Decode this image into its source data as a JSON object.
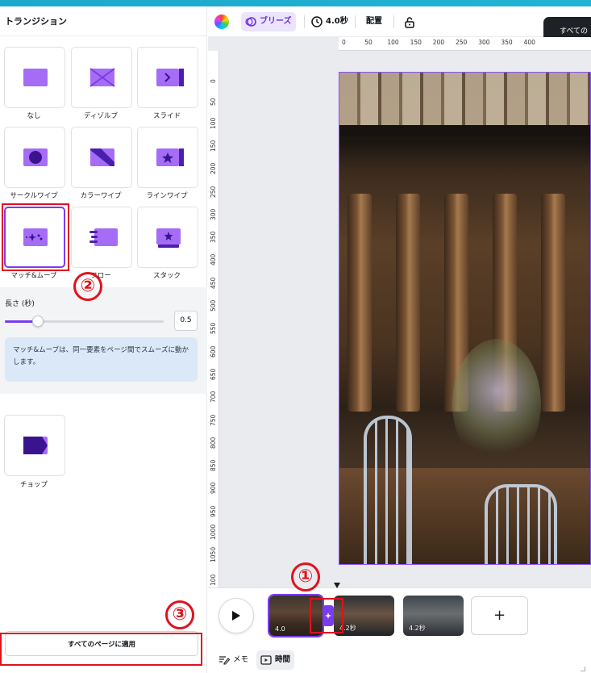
{
  "panel": {
    "title": "トランジション",
    "tiles": [
      {
        "label": "なし",
        "icon": "none-transition-icon"
      },
      {
        "label": "ディゾルブ",
        "icon": "dissolve-transition-icon"
      },
      {
        "label": "スライド",
        "icon": "slide-transition-icon"
      },
      {
        "label": "サークルワイプ",
        "icon": "circle-wipe-icon"
      },
      {
        "label": "カラーワイプ",
        "icon": "color-wipe-icon"
      },
      {
        "label": "ラインワイプ",
        "icon": "line-wipe-icon"
      },
      {
        "label": "マッチ&ムーブ",
        "icon": "match-move-icon",
        "selected": true
      },
      {
        "label": "フロー",
        "icon": "flow-transition-icon"
      },
      {
        "label": "スタック",
        "icon": "stack-transition-icon"
      },
      {
        "label": "チョップ",
        "icon": "chop-transition-icon"
      }
    ],
    "duration_label": "長さ (秒)",
    "duration_value": "0.5",
    "duration_fraction": 0.21,
    "info_text": "マッチ&ムーブは、同一要素をページ間でスムーズに動かします。",
    "apply_button": "すべてのページに適用"
  },
  "annotations": {
    "one": "①",
    "two": "②",
    "three": "③",
    "color": "#e1121c"
  },
  "toolbar": {
    "breeze": "ブリーズ",
    "duration": "4.0秒",
    "arrange": "配置",
    "toast": "すべての"
  },
  "ruler": {
    "top": [
      "0",
      "50",
      "100",
      "150",
      "200",
      "250",
      "300",
      "350",
      "400"
    ],
    "left": [
      "0",
      "50",
      "100",
      "150",
      "200",
      "250",
      "300",
      "350",
      "400",
      "450",
      "500",
      "550",
      "600",
      "650",
      "700",
      "750",
      "800",
      "850",
      "900",
      "950",
      "1000",
      "1050",
      "100"
    ]
  },
  "timeline": {
    "clips": [
      {
        "duration": "4.0",
        "selected": true
      },
      {
        "duration": "4.2秒"
      },
      {
        "duration": "4.2秒"
      }
    ],
    "add_label": "+",
    "notes": "メモ",
    "time": "時間"
  },
  "colors": {
    "accent": "#7a3cf0",
    "annotation": "#e1121c"
  }
}
